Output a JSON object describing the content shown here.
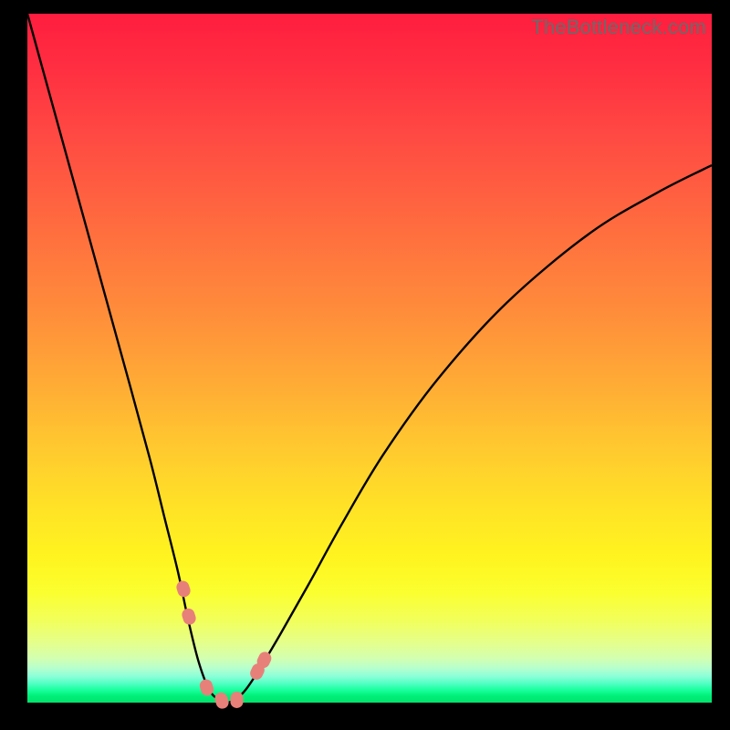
{
  "watermark": "TheBottleneck.com",
  "chart_data": {
    "type": "line",
    "title": "",
    "xlabel": "",
    "ylabel": "",
    "xlim": [
      0,
      100
    ],
    "ylim": [
      0,
      100
    ],
    "grid": false,
    "series": [
      {
        "name": "bottleneck-curve",
        "x": [
          0,
          5,
          10,
          15,
          18,
          20,
          22,
          23.5,
          25,
          26.5,
          27.8,
          29,
          30.5,
          32,
          34,
          37,
          41,
          46,
          52,
          60,
          70,
          82,
          92,
          100
        ],
        "values": [
          100,
          82,
          64,
          46,
          35,
          27,
          19,
          12,
          6,
          2,
          0.5,
          0,
          0.5,
          2,
          5,
          10,
          17,
          26,
          36,
          47,
          58,
          68,
          74,
          78
        ]
      }
    ],
    "markers": [
      {
        "name": "left-shoulder-upper",
        "x": 22.8,
        "y": 16.5
      },
      {
        "name": "left-shoulder-lower",
        "x": 23.6,
        "y": 12.5
      },
      {
        "name": "valley-left",
        "x": 26.2,
        "y": 2.2
      },
      {
        "name": "valley-mid",
        "x": 28.4,
        "y": 0.3
      },
      {
        "name": "valley-right",
        "x": 30.6,
        "y": 0.4
      },
      {
        "name": "right-shoulder-lower",
        "x": 33.6,
        "y": 4.5
      },
      {
        "name": "right-shoulder-upper",
        "x": 34.6,
        "y": 6.2
      }
    ],
    "annotations": []
  },
  "colors": {
    "curve": "#000000",
    "marker": "#e8807a",
    "watermark": "#6a6a6a"
  }
}
